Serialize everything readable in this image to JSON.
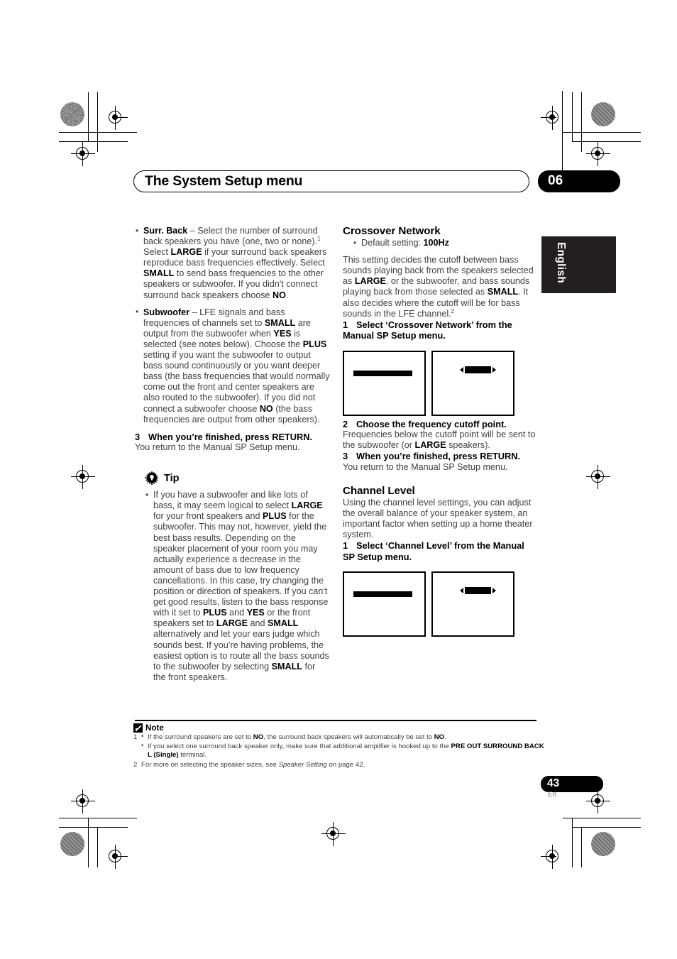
{
  "header": {
    "title": "The System Setup menu",
    "chapter": "06"
  },
  "language_tab": {
    "label": "English"
  },
  "page_footer": {
    "number": "43",
    "language": "En"
  },
  "left_column": {
    "bullets": [
      {
        "term": "Surr. Back",
        "html": "<b>Surr. Back</b> – Select the number of surround back speakers you have (one, two or none).<sup>1</sup> Select <b>LARGE</b> if your surround back speakers reproduce bass frequencies effectively. Select <b>SMALL</b> to send bass frequencies to the other speakers or subwoofer. If you didn't connect surround back speakers choose <b>NO</b>."
      },
      {
        "term": "Subwoofer",
        "html": "<b>Subwoofer</b> – LFE signals and bass frequencies of channels set to <b>SMALL</b> are output from the subwoofer when <b>YES</b> is selected (see notes below). Choose the <b>PLUS</b> setting if you want the subwoofer to output bass sound continuously or you want deeper bass (the bass frequencies that would normally come out the front and center speakers are also routed to the subwoofer). If you did not connect a subwoofer choose <b>NO</b> (the bass frequencies are output from other speakers)."
      }
    ],
    "step3": {
      "num": "3",
      "title": "When you’re finished, press RETURN.",
      "body": "You return to the Manual SP Setup menu."
    },
    "tip": {
      "label": "Tip",
      "icon": "lightbulb-icon",
      "html": "If you have a subwoofer and like lots of bass, it may seem logical to select <b>LARGE</b> for your front speakers and <b>PLUS</b> for the subwoofer. This may not, however, yield the best bass results. Depending on the speaker placement of your room you may actually experience a decrease in the amount of bass due to low frequency cancellations. In this case, try changing the position or direction of speakers. If you can't get good results, listen to the bass response with it set to <b>PLUS</b> and <b>YES</b> or the front speakers set to <b>LARGE</b> and <b>SMALL</b> alternatively and let your ears judge which sounds best. If you’re having problems, the easiest option is to route all the bass sounds to the subwoofer by selecting <b>SMALL</b> for the front speakers."
    }
  },
  "right_column": {
    "crossover": {
      "title": "Crossover Network",
      "default_bullet_html": "Default setting: <b>100Hz</b>",
      "body_html": "This setting decides the cutoff between bass sounds playing back from the speakers selected as <b>LARGE</b>, or the subwoofer, and bass sounds playing back from those selected as <b>SMALL</b>. It also decides where the cutoff will be for bass sounds in the LFE channel.<sup>2</sup>",
      "step1": {
        "num": "1",
        "title": "Select ‘Crossover Network’ from the Manual SP Setup menu."
      },
      "step2": {
        "num": "2",
        "title": "Choose the frequency cutoff point.",
        "body_html": "Frequencies below the cutoff point will be sent to the subwoofer (or <b>LARGE</b> speakers)."
      },
      "step3": {
        "num": "3",
        "title": "When you’re finished, press RETURN.",
        "body": "You return to the Manual SP Setup menu."
      }
    },
    "channel_level": {
      "title": "Channel Level",
      "body": "Using the channel level settings, you can adjust the overall balance of your speaker system, an important factor when setting up a home theater system.",
      "step1": {
        "num": "1",
        "title": "Select ‘Channel Level’ from the Manual SP Setup menu."
      }
    }
  },
  "notes": {
    "label": "Note",
    "icon": "pencil-note-icon",
    "items": [
      {
        "num": "1",
        "bullets": [
          "If the surround speakers are set to <b>NO</b>, the surround back speakers will automatically be set to <b>NO</b>.",
          "If you select one surround back speaker only, make sure that additional amplifier is hooked up to the <b>PRE OUT SURROUND BACK L (Single)</b> terminal."
        ]
      },
      {
        "num": "2",
        "bullets": [
          "For more on selecting the speaker sizes, see <i>Speaker Setting</i> on page 42."
        ]
      }
    ]
  }
}
